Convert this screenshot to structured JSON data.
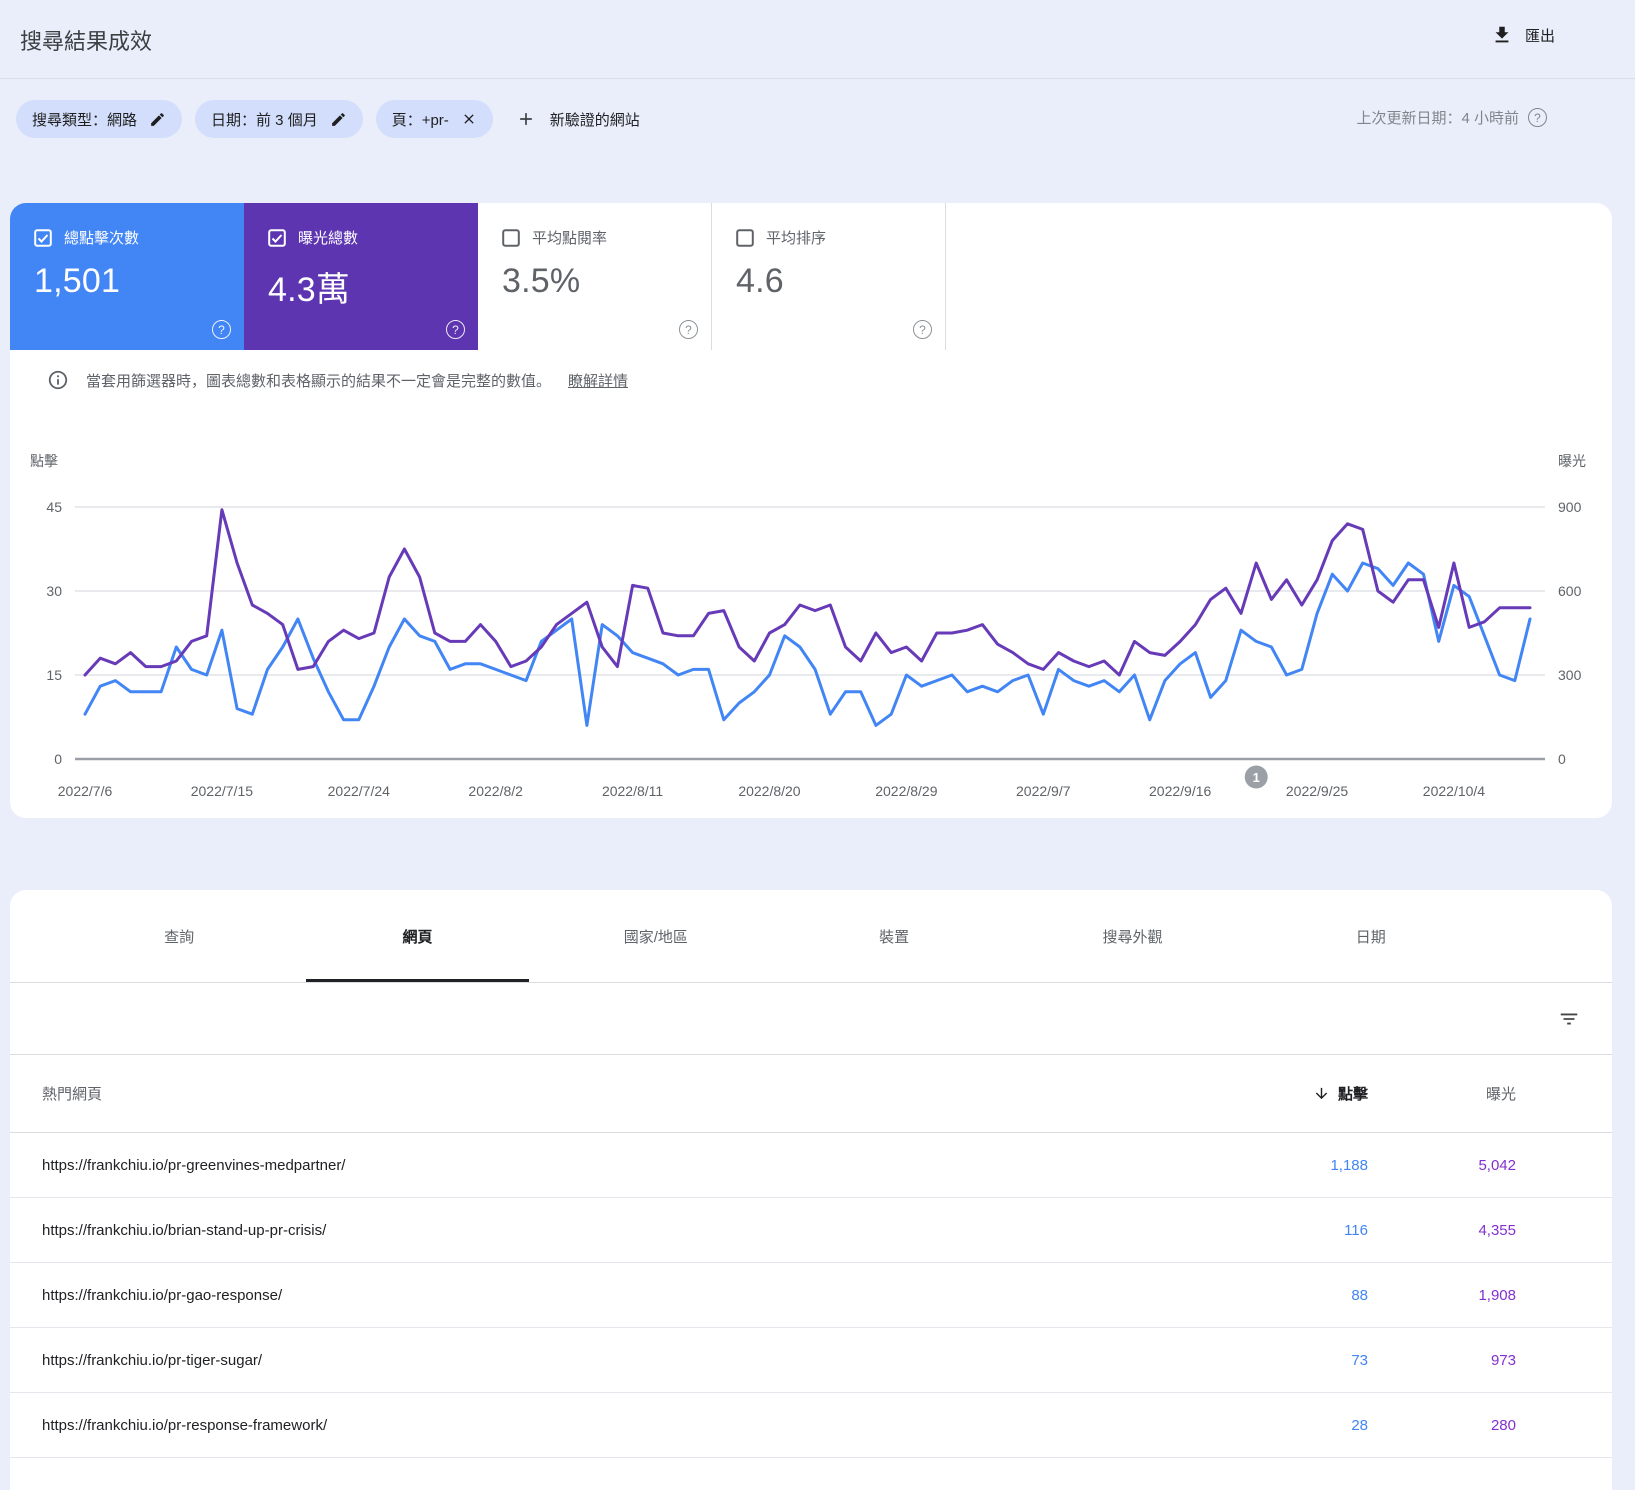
{
  "header": {
    "title": "搜尋結果成效",
    "export_label": "匯出"
  },
  "filters": {
    "chips": [
      {
        "label": "搜尋類型：網路",
        "action": "edit"
      },
      {
        "label": "日期：前 3 個月",
        "action": "edit"
      },
      {
        "label": "頁：+pr-",
        "action": "remove"
      }
    ],
    "new_site_label": "新驗證的網站",
    "last_updated": "上次更新日期：4 小時前"
  },
  "icons": {
    "help_glyph": "?"
  },
  "metrics": [
    {
      "label": "總點擊次數",
      "value": "1,501",
      "checked": true,
      "color": "#4285f4"
    },
    {
      "label": "曝光總數",
      "value": "4.3萬",
      "checked": true,
      "color": "#5e35b1"
    },
    {
      "label": "平均點閱率",
      "value": "3.5%",
      "checked": false,
      "color": "#ffffff"
    },
    {
      "label": "平均排序",
      "value": "4.6",
      "checked": false,
      "color": "#ffffff"
    }
  ],
  "notice": {
    "text": "當套用篩選器時，圖表總數和表格顯示的結果不一定會是完整的數值。",
    "link": "瞭解詳情"
  },
  "chart_data": {
    "type": "line",
    "x_start_date": "2022/7/6",
    "x_tick_labels": [
      "2022/7/6",
      "2022/7/15",
      "2022/7/24",
      "2022/8/2",
      "2022/8/11",
      "2022/8/20",
      "2022/8/29",
      "2022/9/7",
      "2022/9/16",
      "2022/9/25",
      "2022/10/4"
    ],
    "x_tick_day_index": [
      0,
      9,
      18,
      27,
      36,
      45,
      54,
      63,
      72,
      81,
      90
    ],
    "left_axis": {
      "label": "點擊",
      "ticks": [
        45,
        30,
        15,
        0
      ],
      "max": 45
    },
    "right_axis": {
      "label": "曝光",
      "ticks": [
        900,
        600,
        300,
        0
      ],
      "max": 900
    },
    "grid": true,
    "series": [
      {
        "name": "點擊",
        "axis": "left",
        "color": "#4285f4",
        "values": [
          8,
          13,
          14,
          12,
          12,
          12,
          20,
          16,
          15,
          23,
          9,
          8,
          16,
          20,
          25,
          18,
          12,
          7,
          7,
          13,
          20,
          25,
          22,
          21,
          16,
          17,
          17,
          16,
          15,
          14,
          21,
          23,
          25,
          6,
          24,
          22,
          19,
          18,
          17,
          15,
          16,
          16,
          7,
          10,
          12,
          15,
          22,
          20,
          16,
          8,
          12,
          12,
          6,
          8,
          15,
          13,
          14,
          15,
          12,
          13,
          12,
          14,
          15,
          8,
          16,
          14,
          13,
          14,
          12,
          15,
          7,
          14,
          17,
          19,
          11,
          14,
          23,
          21,
          20,
          15,
          16,
          26,
          33,
          30,
          35,
          34,
          31,
          35,
          33,
          21,
          31,
          29,
          22,
          15,
          14,
          25
        ]
      },
      {
        "name": "曝光",
        "axis": "right",
        "color": "#673ab7",
        "values": [
          300,
          360,
          340,
          380,
          330,
          330,
          350,
          420,
          440,
          890,
          700,
          550,
          520,
          480,
          320,
          330,
          420,
          460,
          430,
          450,
          650,
          750,
          650,
          450,
          420,
          420,
          480,
          420,
          330,
          350,
          400,
          480,
          520,
          560,
          400,
          330,
          620,
          610,
          450,
          440,
          440,
          520,
          530,
          400,
          350,
          450,
          480,
          550,
          530,
          550,
          400,
          350,
          450,
          380,
          400,
          350,
          450,
          450,
          460,
          480,
          410,
          380,
          340,
          320,
          380,
          350,
          330,
          350,
          300,
          420,
          380,
          370,
          420,
          480,
          570,
          610,
          520,
          700,
          570,
          640,
          550,
          640,
          780,
          840,
          820,
          600,
          560,
          640,
          640,
          470,
          700,
          470,
          490,
          540,
          540,
          540
        ]
      }
    ],
    "annotation": {
      "label": "1",
      "day_index": 77
    }
  },
  "table": {
    "tabs": [
      "查詢",
      "網頁",
      "國家/地區",
      "裝置",
      "搜尋外觀",
      "日期"
    ],
    "active_tab": "網頁",
    "primary_column": "熱門網頁",
    "clicks_column": "點擊",
    "impressions_column": "曝光",
    "sort": "clicks-desc",
    "clicks_color": "#4285f4",
    "impressions_color": "#8430ce",
    "rows": [
      {
        "url": "https://frankchiu.io/pr-greenvines-medpartner/",
        "clicks": "1,188",
        "impressions": "5,042"
      },
      {
        "url": "https://frankchiu.io/brian-stand-up-pr-crisis/",
        "clicks": "116",
        "impressions": "4,355"
      },
      {
        "url": "https://frankchiu.io/pr-gao-response/",
        "clicks": "88",
        "impressions": "1,908"
      },
      {
        "url": "https://frankchiu.io/pr-tiger-sugar/",
        "clicks": "73",
        "impressions": "973"
      },
      {
        "url": "https://frankchiu.io/pr-response-framework/",
        "clicks": "28",
        "impressions": "280"
      }
    ]
  }
}
